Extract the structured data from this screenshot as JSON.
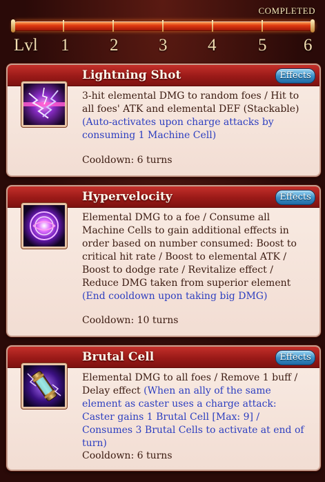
{
  "header": {
    "status": "COMPLETED",
    "level_label": "Lvl",
    "levels": [
      "1",
      "2",
      "3",
      "4",
      "5",
      "6"
    ],
    "progress": 1.0
  },
  "skills": [
    {
      "name": "Lightning Shot",
      "effects_label": "Effects",
      "icon": "lightning-bolt-icon",
      "description": "3-hit elemental DMG to random foes / Hit to all foes' ATK and elemental DEF (Stackable) ",
      "description_note": "(Auto-activates upon charge attacks by consuming 1 Machine Cell)",
      "cooldown": "Cooldown: 6 turns"
    },
    {
      "name": "Hypervelocity",
      "effects_label": "Effects",
      "icon": "energy-orb-icon",
      "description": "Elemental DMG to a foe / Consume all Machine Cells to gain additional effects in order based on number consumed: Boost to critical hit rate / Boost to elemental ATK / Boost to dodge rate / Revitalize effect / Reduce DMG taken from superior element ",
      "description_note": "(End cooldown upon taking big DMG)",
      "cooldown": "Cooldown: 10 turns"
    },
    {
      "name": "Brutal Cell",
      "effects_label": "Effects",
      "icon": "energy-cell-icon",
      "description": "Elemental DMG to all foes / Remove 1 buff / Delay effect ",
      "description_note": "(When an ally of the same element as caster uses a charge attack: Caster gains 1 Brutal Cell [Max: 9] / Consumes 3 Brutal Cells to activate at end of turn)",
      "cooldown": "Cooldown: 6 turns"
    }
  ]
}
